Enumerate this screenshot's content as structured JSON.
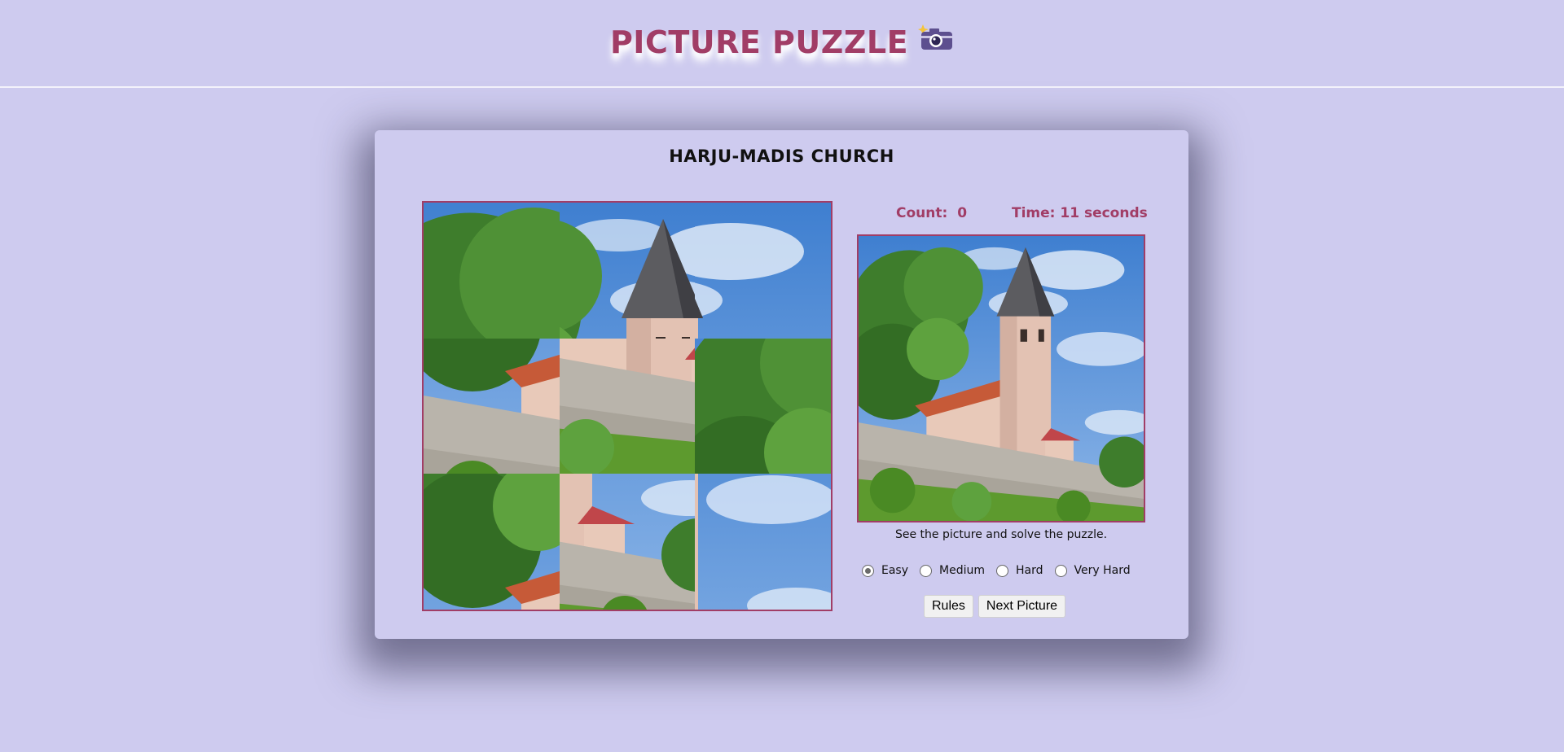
{
  "site": {
    "title": "PICTURE PUZZLE",
    "icon": "camera-with-flash-icon"
  },
  "puzzle": {
    "picture_title": "HARJU-MADIS CHURCH",
    "grid": "3x3",
    "tiles": [
      {
        "piece": "church-tower-left-wall"
      },
      {
        "piece": "spire-sky-tree"
      },
      {
        "piece": "tower-top-sky"
      },
      {
        "piece": "tree-wall"
      },
      {
        "piece": "stone-wall-greenery"
      },
      {
        "piece": "tree-foliage"
      },
      {
        "piece": "tree-trunk-bottom"
      },
      {
        "piece": "church-corner-wall"
      },
      {
        "piece": "cloudy-sky"
      }
    ]
  },
  "stats": {
    "count_label": "Count:",
    "count_value": "0",
    "time_label": "Time: 11 seconds"
  },
  "reference": {
    "caption": "See the picture and solve the puzzle."
  },
  "difficulty": {
    "options": [
      "Easy",
      "Medium",
      "Hard",
      "Very Hard"
    ],
    "selected": "Easy"
  },
  "buttons": {
    "rules": "Rules",
    "next": "Next Picture"
  },
  "colors": {
    "accent": "#a13d66",
    "background": "#cecbef"
  }
}
